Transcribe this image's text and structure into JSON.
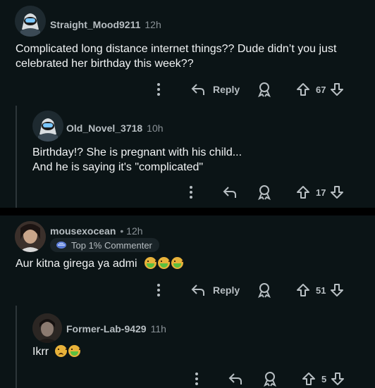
{
  "comments": [
    {
      "user": "Straight_Mood9211",
      "time": "12h",
      "text": "Complicated long distance internet things?? Dude didn’t you just celebrated her birthday this week??",
      "reply_label": "Reply",
      "votes": "67"
    },
    {
      "user": "Old_Novel_3718",
      "time": "10h",
      "text_line1": "Birthday!? She is pregnant with his child...",
      "text_line2": "And he is saying it's \"complicated\"",
      "votes": "17"
    },
    {
      "user": "mousexocean",
      "time": "• 12h",
      "badge": "Top 1% Commenter",
      "text": "Aur kitna girega ya admi",
      "reply_label": "Reply",
      "votes": "51"
    },
    {
      "user": "Former-Lab-9429",
      "time": "11h",
      "text": "Ikrr",
      "votes": "5"
    }
  ],
  "icons": {
    "more": "more-vertical-icon",
    "reply": "reply-arrow-icon",
    "award": "award-icon",
    "upvote": "upvote-icon",
    "downvote": "downvote-icon",
    "badge": "top-commenter-icon"
  },
  "colors": {
    "background": "#0b1416",
    "separator": "#000000",
    "text": "#f2f4f5",
    "muted": "#8a9297"
  }
}
